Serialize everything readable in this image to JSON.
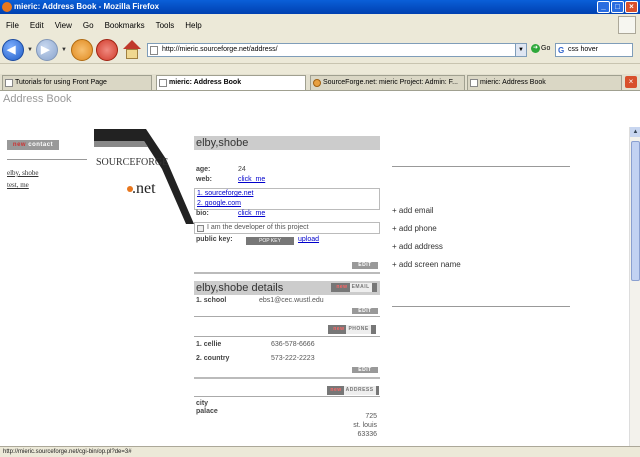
{
  "window": {
    "title": "mieric: Address Book - Mozilla Firefox"
  },
  "menu": [
    "File",
    "Edit",
    "View",
    "Go",
    "Bookmarks",
    "Tools",
    "Help"
  ],
  "nav": {
    "url": "http://mieric.sourceforge.net/address/",
    "go_label": "Go",
    "search_value": "css hover"
  },
  "tabs": [
    {
      "label": "Tutorials for using Front Page",
      "active": false
    },
    {
      "label": "mieric: Address Book",
      "active": true
    },
    {
      "label": "SourceForge.net: mieric Project: Admin: F...",
      "active": false
    },
    {
      "label": "mieric: Address Book",
      "active": false
    }
  ],
  "page": {
    "title": "Address Book",
    "new_contact": {
      "badge": "new",
      "label": "contact"
    },
    "contacts": [
      "elby, shobe",
      "test, me"
    ],
    "logo": {
      "line1": "SOURCEFORGE",
      "line2": ".net"
    },
    "card": {
      "name": "elby,shobe",
      "age_label": "age:",
      "age": "24",
      "web_label": "web:",
      "web_link": "click_me",
      "links": [
        "1. sourceforge.net",
        "2. google.com"
      ],
      "bio_label": "bio:",
      "bio_link": "click_me",
      "bio_text": "I am the developer of this project",
      "pubkey_label": "public key:",
      "pubkey_btn": "POP KEY",
      "upload": "upload",
      "edit": "EDIT"
    },
    "details": {
      "title": "elby,shobe details",
      "new_email": {
        "badge": "new",
        "label": "EMAIL"
      },
      "email_label": "1. school",
      "email_value": "ebs1@cec.wustl.edu",
      "new_phone": {
        "badge": "new",
        "label": "PHONE"
      },
      "phones": [
        {
          "label": "1. cellie",
          "value": "636-578-6666"
        },
        {
          "label": "2. country",
          "value": "573-222-2223"
        }
      ],
      "new_address": {
        "badge": "new",
        "label": "ADDRESS"
      },
      "address_labels": [
        "city",
        "palace"
      ],
      "address_lines": [
        "725",
        "st. louis",
        "63336"
      ],
      "edit": "EDIT"
    },
    "actions": [
      "+ add email",
      "+ add phone",
      "+ add address",
      "+ add screen name"
    ]
  },
  "status": "http://mieric.sourceforge.net/cgi-bin/op.pl?de=3#"
}
